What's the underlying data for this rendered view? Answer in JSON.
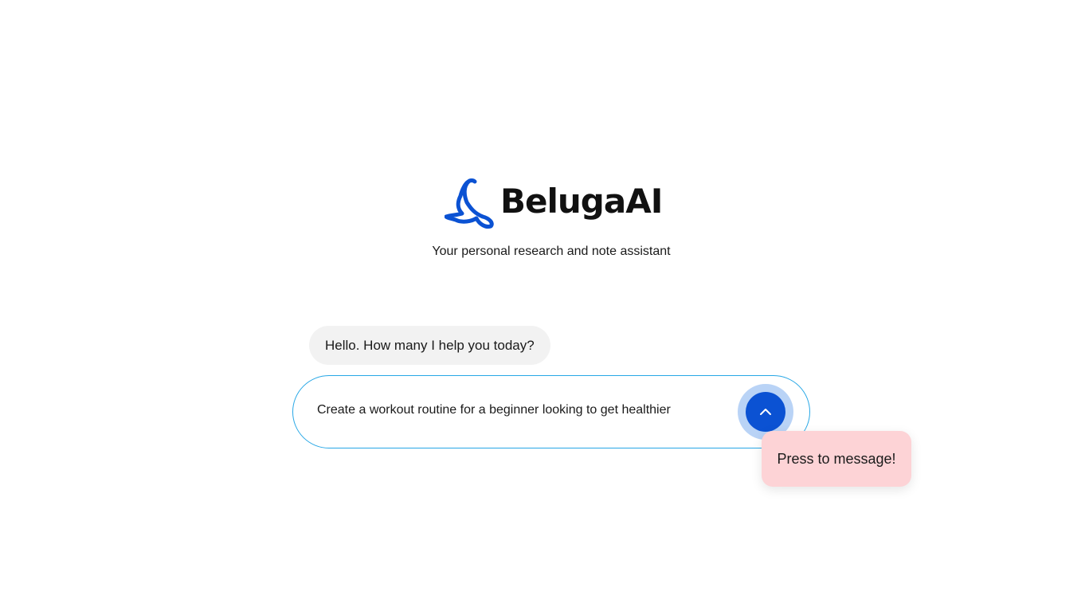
{
  "brand": {
    "name": "BelugaAI",
    "tagline": "Your personal research and note assistant",
    "logo_icon": "beluga-whale-icon",
    "accent_color": "#0b52d3"
  },
  "chat": {
    "bot_greeting": "Hello. How many I help you today?"
  },
  "composer": {
    "input_value": "Create a workout routine for a beginner looking to get healthier",
    "send_icon": "chevron-up-icon",
    "border_color": "#27a7e6"
  },
  "tooltip": {
    "text": "Press to message!",
    "background": "#fdd3d6"
  }
}
